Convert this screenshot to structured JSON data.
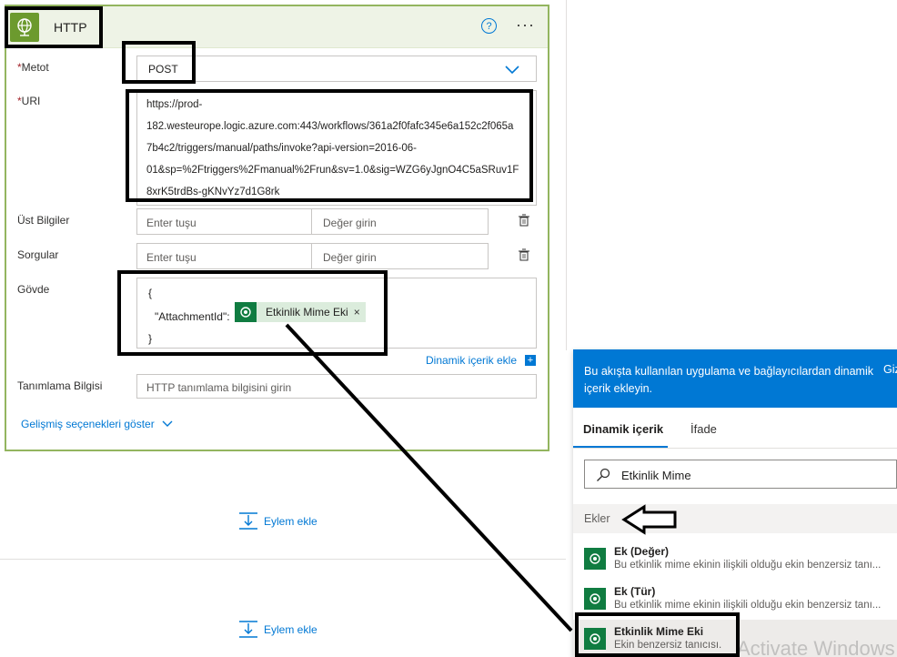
{
  "card": {
    "title": "HTTP",
    "help_glyph": "?",
    "more_glyph": "···"
  },
  "fields": {
    "method": {
      "required_mark": "*",
      "label": "Metot",
      "value": "POST"
    },
    "uri": {
      "required_mark": "*",
      "label": "URI",
      "lines": [
        "https://prod-",
        "182.westeurope.logic.azure.com:443/workflows/361a2f0fafc345e6a152c2f065a",
        "7b4c2/triggers/manual/paths/invoke?api-version=2016-06-",
        "01&sp=%2Ftriggers%2Fmanual%2Frun&sv=1.0&sig=WZG6yJgnO4C5aSRuv1F",
        "8xrK5trdBs-gKNvYz7d1G8rk"
      ]
    },
    "headers": {
      "label": "Üst Bilgiler",
      "key_placeholder": "Enter tuşu",
      "value_placeholder": "Değer girin"
    },
    "queries": {
      "label": "Sorgular",
      "key_placeholder": "Enter tuşu",
      "value_placeholder": "Değer girin"
    },
    "body": {
      "label": "Gövde",
      "line1": "{",
      "key": "\"AttachmentId\":",
      "token": "Etkinlik Mime Eki",
      "token_close": "×",
      "line3": "}"
    },
    "dynamic_link": "Dinamik içerik ekle",
    "dynamic_plus": "+",
    "auth": {
      "label": "Tanımlama Bilgisi",
      "placeholder": "HTTP tanımlama bilgisini girin"
    },
    "advanced": "Gelişmiş seçenekleri göster"
  },
  "canvas": {
    "add_action_1": "Eylem ekle",
    "add_action_2": "Eylem ekle"
  },
  "dynamic_panel": {
    "header_text": "Bu akışta kullanılan uygulama ve bağlayıcılardan dinamik içerik ekleyin.",
    "header_extra": "Giz",
    "tabs": [
      "Dinamik içerik",
      "İfade"
    ],
    "search_value": "Etkinlik Mime",
    "section": "Ekler",
    "items": [
      {
        "title": "Ek (Değer)",
        "desc": "Bu etkinlik mime ekinin ilişkili olduğu ekin benzersiz tanı..."
      },
      {
        "title": "Ek (Tür)",
        "desc": "Bu etkinlik mime ekinin ilişkili olduğu ekin benzersiz tanı..."
      },
      {
        "title": "Etkinlik Mime Eki",
        "desc": "Ekin benzersiz tanıcısı."
      }
    ]
  },
  "watermark": "Activate Windows",
  "colors": {
    "accent": "#0078d4",
    "card_border": "#93b55f",
    "header_bg": "#eef3e6",
    "connector_green": "#107c41",
    "http_icon": "#6c9a2e"
  }
}
